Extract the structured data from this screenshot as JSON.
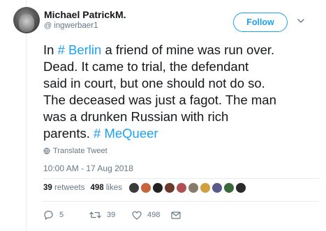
{
  "user": {
    "display_name": "Michael PatrickM.",
    "handle": "ingwerbaer1"
  },
  "follow_label": "Follow",
  "tweet": {
    "lines": [
      [
        {
          "t": "In "
        },
        {
          "hash": "#",
          "tag": "Berlin"
        },
        {
          "t": " a friend of mine was run over."
        }
      ],
      [
        {
          "t": "Dead. It came to trial, the defendant"
        }
      ],
      [
        {
          "t": "said in court, but one should not do so."
        }
      ],
      [
        {
          "t": "The deceased was just a fagot. The man"
        }
      ],
      [
        {
          "t": "was a drunken Russian with rich"
        }
      ],
      [
        {
          "t": "parents. "
        },
        {
          "hash": "#",
          "tag": "MeQueer"
        }
      ]
    ]
  },
  "translate_label": "Translate Tweet",
  "timestamp": "10:00 AM - 17 Aug 2018",
  "stats": {
    "retweets_count": "39",
    "retweets_label": "retweets",
    "likes_count": "498",
    "likes_label": "likes"
  },
  "likers_colors": [
    "#3b3b3b",
    "#c8643c",
    "#222222",
    "#6a3b2a",
    "#b05050",
    "#8a7a6a",
    "#d0a040",
    "#5a5a8a",
    "#3a6a3a",
    "#2a2a2a"
  ],
  "actions": {
    "replies": "5",
    "retweets": "39",
    "likes": "498"
  },
  "colors": {
    "accent": "#1da1f2",
    "secondary_text": "#657786"
  }
}
